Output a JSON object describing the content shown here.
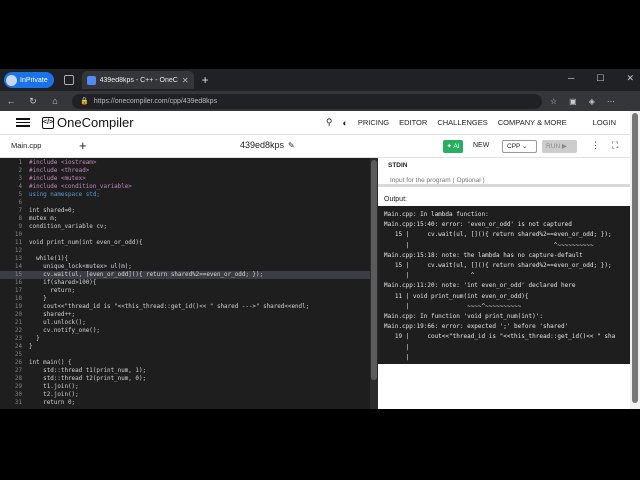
{
  "browser": {
    "profile": "InPrivate",
    "tab_title": "439ed8kps - C++ - OneCompiler",
    "url": "https://onecompiler.com/cpp/439ed8kps"
  },
  "appnav": {
    "brand": "OneCompiler",
    "logo_glyph": "</>",
    "items": [
      "PRICING",
      "EDITOR",
      "CHALLENGES",
      "COMPANY & MORE"
    ],
    "login": "LOGIN"
  },
  "toolbar": {
    "file": "Main.cpp",
    "program": "439ed8kps",
    "ai": "AI",
    "new": "NEW",
    "lang": "CPP",
    "run": "RUN"
  },
  "editor": {
    "lines": [
      {
        "n": "1",
        "t": "#include <iostream>",
        "k": "pp"
      },
      {
        "n": "2",
        "t": "#include <thread>",
        "k": "pp"
      },
      {
        "n": "3",
        "t": "#include <mutex>",
        "k": "pp"
      },
      {
        "n": "4",
        "t": "#include <condition_variable>",
        "k": "pp"
      },
      {
        "n": "5",
        "t": "using namespace std;",
        "k": "kw"
      },
      {
        "n": "6",
        "t": "",
        "k": ""
      },
      {
        "n": "7",
        "t": "int shared=0;",
        "k": ""
      },
      {
        "n": "8",
        "t": "mutex m;",
        "k": ""
      },
      {
        "n": "9",
        "t": "condition_variable cv;",
        "k": ""
      },
      {
        "n": "10",
        "t": "",
        "k": ""
      },
      {
        "n": "11",
        "t": "void print_num(int even_or_odd){",
        "k": ""
      },
      {
        "n": "12",
        "t": "",
        "k": ""
      },
      {
        "n": "13",
        "t": "  while(1){",
        "k": ""
      },
      {
        "n": "14",
        "t": "    unique_lock<mutex> ul(m);",
        "k": ""
      },
      {
        "n": "15",
        "t": "    cv.wait(ul, [even_or_odd](){ return shared%2==even_or_odd; });",
        "k": "",
        "hl": true
      },
      {
        "n": "16",
        "t": "    if(shared>100){",
        "k": ""
      },
      {
        "n": "17",
        "t": "      return;",
        "k": ""
      },
      {
        "n": "18",
        "t": "    }",
        "k": ""
      },
      {
        "n": "19",
        "t": "    cout<<\"thread_id is \"<<this_thread::get_id()<< \" shared --->\" shared<<endl;",
        "k": ""
      },
      {
        "n": "20",
        "t": "    shared++;",
        "k": ""
      },
      {
        "n": "21",
        "t": "    ul.unlock();",
        "k": ""
      },
      {
        "n": "22",
        "t": "    cv.notify_one();",
        "k": ""
      },
      {
        "n": "23",
        "t": "  }",
        "k": ""
      },
      {
        "n": "24",
        "t": "}",
        "k": ""
      },
      {
        "n": "25",
        "t": "",
        "k": ""
      },
      {
        "n": "26",
        "t": "int main() {",
        "k": ""
      },
      {
        "n": "27",
        "t": "    std::thread t1(print_num, 1);",
        "k": ""
      },
      {
        "n": "28",
        "t": "    std::thread t2(print_num, 0);",
        "k": ""
      },
      {
        "n": "29",
        "t": "    t1.join();",
        "k": ""
      },
      {
        "n": "30",
        "t": "    t2.join();",
        "k": ""
      },
      {
        "n": "31",
        "t": "    return 0;",
        "k": ""
      }
    ]
  },
  "right": {
    "stdin_label": "STDIN",
    "stdin_placeholder": "Input for the program ( Optional )",
    "output_label": "Output:",
    "output_lines": [
      "Main.cpp: In lambda function:",
      "Main.cpp:15:40: error: 'even_or_odd' is not captured",
      "   15 |     cv.wait(ul, [](){ return shared%2==even_or_odd; });",
      "      |                                        ^~~~~~~~~~~",
      "Main.cpp:15:18: note: the lambda has no capture-default",
      "   15 |     cv.wait(ul, [](){ return shared%2==even_or_odd; });",
      "      |                 ^",
      "Main.cpp:11:20: note: 'int even_or_odd' declared here",
      "   11 | void print_num(int even_or_odd){",
      "      |                ~~~~^~~~~~~~~~~",
      "Main.cpp: In function 'void print_num(int)':",
      "Main.cpp:19:66: error: expected ';' before 'shared'",
      "   19 |     cout<<\"thread_id is \"<<this_thread::get_id()<< \" sha",
      "      |",
      "      |"
    ]
  }
}
